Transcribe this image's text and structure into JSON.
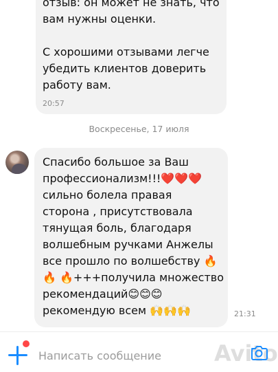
{
  "chat": {
    "previous_message": {
      "lines": [
        "отзыв: он может не знать, что",
        "вам нужны оценки.",
        "С хорошими отзывами легче",
        "убедить клиентов доверить",
        "работу вам."
      ],
      "time": "20:57"
    },
    "date_separator": "Воскресенье, 17 июля",
    "incoming_message": {
      "avatar_icon": "user-avatar",
      "lines": [
        "Спасибо большое за Ваш",
        "профессионализм!!!❤️❤️❤️",
        "сильно болела правая",
        "сторона , присутствовала",
        "тянущая боль, благодаря",
        "волшебным ручками Анжелы",
        "все прошло по волшебству 🔥",
        "🔥 🔥+++получила множество",
        "рекомендаций😊😊😊",
        "рекомендую всем 🙌🙌🙌"
      ],
      "time": "21:31"
    }
  },
  "composer": {
    "attach_icon": "plus-icon",
    "input_placeholder": "Написать сообщение",
    "input_value": "",
    "camera_icon": "camera-icon",
    "watermark": "Avito",
    "accent_color": "#1a8cff",
    "badge_color": "#ff4747"
  }
}
